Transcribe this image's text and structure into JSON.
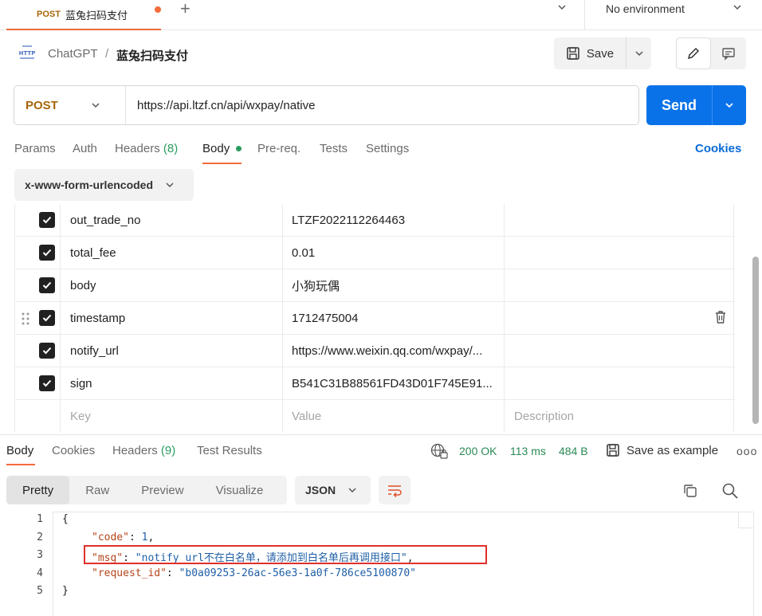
{
  "tab": {
    "method": "POST",
    "name": "蓝兔扫码支付"
  },
  "environment": {
    "label": "No environment"
  },
  "breadcrumb": {
    "icon": "http-icon",
    "icon_text": "HTTP",
    "parent": "ChatGPT",
    "separator": "/",
    "current": "蓝兔扫码支付"
  },
  "toolbar": {
    "save_label": "Save"
  },
  "request": {
    "method": "POST",
    "url": "https://api.ltzf.cn/api/wxpay/native",
    "send_label": "Send"
  },
  "request_tabs": [
    {
      "label": "Params"
    },
    {
      "label": "Auth"
    },
    {
      "label": "Headers",
      "count": "(8)"
    },
    {
      "label": "Body"
    },
    {
      "label": "Pre-req."
    },
    {
      "label": "Tests"
    },
    {
      "label": "Settings"
    }
  ],
  "cookies_label": "Cookies",
  "body_encoding": "x-www-form-urlencoded",
  "params": [
    {
      "key": "out_trade_no",
      "value": "LTZF2022112264463"
    },
    {
      "key": "total_fee",
      "value": "0.01"
    },
    {
      "key": "body",
      "value": "小狗玩偶"
    },
    {
      "key": "timestamp",
      "value": "1712475004"
    },
    {
      "key": "notify_url",
      "value": "https://www.weixin.qq.com/wxpay/..."
    },
    {
      "key": "sign",
      "value": "B541C31B88561FD43D01F745E91..."
    }
  ],
  "params_placeholder": {
    "key": "Key",
    "value": "Value",
    "description": "Description"
  },
  "response_tabs": [
    {
      "label": "Body"
    },
    {
      "label": "Cookies"
    },
    {
      "label": "Headers",
      "count": "(9)"
    },
    {
      "label": "Test Results"
    }
  ],
  "response_meta": {
    "status": "200 OK",
    "time": "113 ms",
    "size": "484 B",
    "save_example": "Save as example",
    "more": "ooo"
  },
  "view_options": [
    "Pretty",
    "Raw",
    "Preview",
    "Visualize"
  ],
  "format": "JSON",
  "code": {
    "line_numbers": [
      "1",
      "2",
      "3",
      "4",
      "5"
    ],
    "open_brace": "{",
    "close_brace": "}",
    "code_key": "\"code\"",
    "code_value": "1",
    "msg_key": "\"msg\"",
    "msg_value": "\"notify_url不在白名单，请添加到白名单后再调用接口\"",
    "request_id_key": "\"request_id\"",
    "request_id_value": "\"b0a09253-26ac-56e3-1a0f-786ce5100870\""
  },
  "colors": {
    "accent": "#f26b3a",
    "send": "#0a72e8",
    "method": "#a8650a",
    "status": "#2a8a55",
    "highlight": "#e0302a"
  }
}
